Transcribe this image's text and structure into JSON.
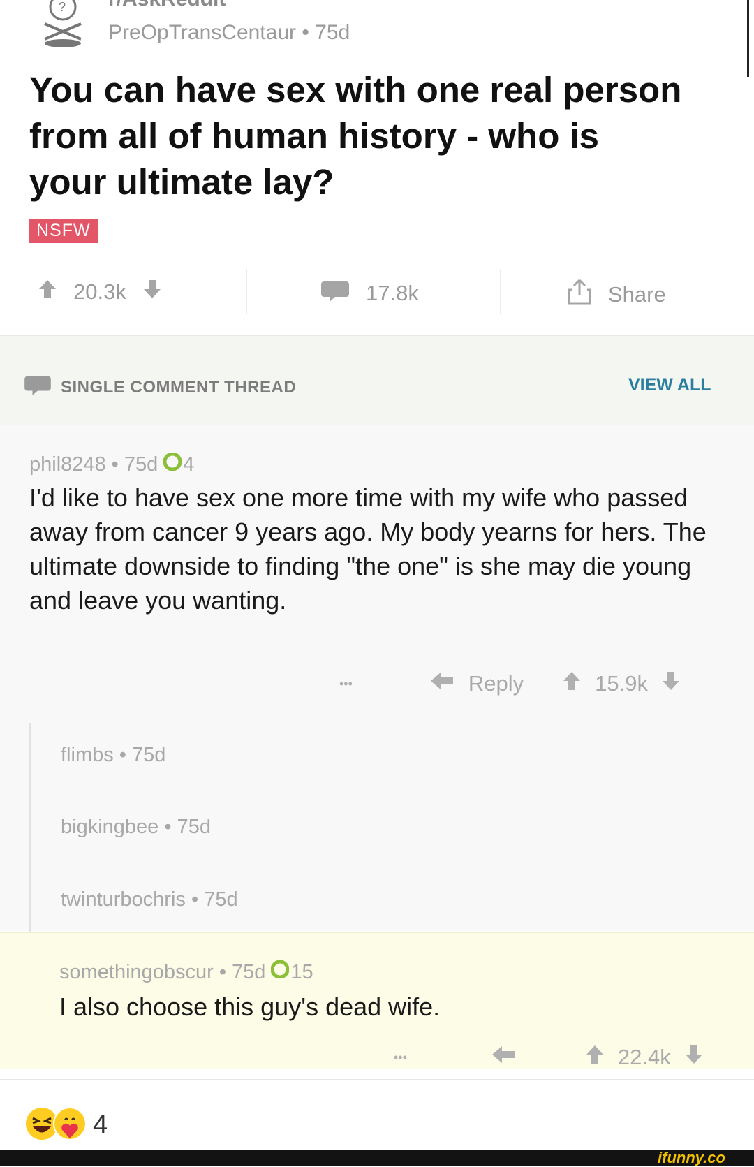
{
  "post": {
    "subreddit": "r/AskReddit",
    "author": "PreOpTransCentaur",
    "age": "75d",
    "title": "You can have sex with one real person from all of human history - who is your ultimate lay?",
    "flair": "NSFW"
  },
  "actions": {
    "upvotes": "20.3k",
    "comments": "17.8k",
    "share_label": "Share"
  },
  "thread": {
    "label": "SINGLE COMMENT THREAD",
    "view_all": "VIEW ALL"
  },
  "comment": {
    "author": "phil8248",
    "age": "75d",
    "award_count": "4",
    "body": "I'd like to have sex one more time with my wife who passed away from cancer 9 years ago.  My body yearns for hers.  The ultimate downside to finding \"the one\" is she may die young and leave you wanting.",
    "more": "•••",
    "reply_label": "Reply",
    "score": "15.9k"
  },
  "replies": [
    {
      "author": "flimbs",
      "age": "75d"
    },
    {
      "author": "bigkingbee",
      "age": "75d"
    },
    {
      "author": "twinturbochris",
      "age": "75d"
    }
  ],
  "highlighted": {
    "author": "somethingobscur",
    "age": "75d",
    "award_count": "15",
    "body": "I also choose this guy's dead wife.",
    "more": "•••",
    "score": "22.4k"
  },
  "reactions": {
    "count": "4"
  },
  "watermark": "ifunny.co",
  "colors": {
    "nsfw": "#e25667",
    "view_all": "#2a7fa0",
    "highlight_bg": "#fdfce6",
    "award": "#8bbf3a"
  }
}
